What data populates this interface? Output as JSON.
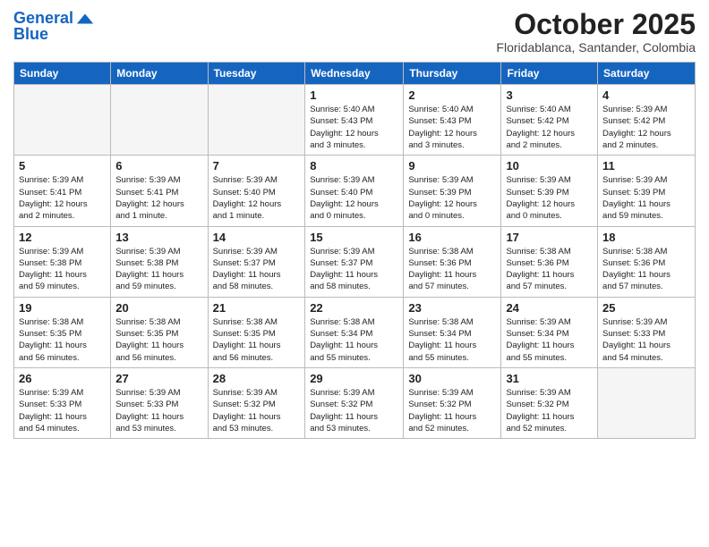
{
  "header": {
    "logo_line1": "General",
    "logo_line2": "Blue",
    "month": "October 2025",
    "location": "Floridablanca, Santander, Colombia"
  },
  "weekdays": [
    "Sunday",
    "Monday",
    "Tuesday",
    "Wednesday",
    "Thursday",
    "Friday",
    "Saturday"
  ],
  "weeks": [
    [
      {
        "day": "",
        "info": ""
      },
      {
        "day": "",
        "info": ""
      },
      {
        "day": "",
        "info": ""
      },
      {
        "day": "1",
        "info": "Sunrise: 5:40 AM\nSunset: 5:43 PM\nDaylight: 12 hours\nand 3 minutes."
      },
      {
        "day": "2",
        "info": "Sunrise: 5:40 AM\nSunset: 5:43 PM\nDaylight: 12 hours\nand 3 minutes."
      },
      {
        "day": "3",
        "info": "Sunrise: 5:40 AM\nSunset: 5:42 PM\nDaylight: 12 hours\nand 2 minutes."
      },
      {
        "day": "4",
        "info": "Sunrise: 5:39 AM\nSunset: 5:42 PM\nDaylight: 12 hours\nand 2 minutes."
      }
    ],
    [
      {
        "day": "5",
        "info": "Sunrise: 5:39 AM\nSunset: 5:41 PM\nDaylight: 12 hours\nand 2 minutes."
      },
      {
        "day": "6",
        "info": "Sunrise: 5:39 AM\nSunset: 5:41 PM\nDaylight: 12 hours\nand 1 minute."
      },
      {
        "day": "7",
        "info": "Sunrise: 5:39 AM\nSunset: 5:40 PM\nDaylight: 12 hours\nand 1 minute."
      },
      {
        "day": "8",
        "info": "Sunrise: 5:39 AM\nSunset: 5:40 PM\nDaylight: 12 hours\nand 0 minutes."
      },
      {
        "day": "9",
        "info": "Sunrise: 5:39 AM\nSunset: 5:39 PM\nDaylight: 12 hours\nand 0 minutes."
      },
      {
        "day": "10",
        "info": "Sunrise: 5:39 AM\nSunset: 5:39 PM\nDaylight: 12 hours\nand 0 minutes."
      },
      {
        "day": "11",
        "info": "Sunrise: 5:39 AM\nSunset: 5:39 PM\nDaylight: 11 hours\nand 59 minutes."
      }
    ],
    [
      {
        "day": "12",
        "info": "Sunrise: 5:39 AM\nSunset: 5:38 PM\nDaylight: 11 hours\nand 59 minutes."
      },
      {
        "day": "13",
        "info": "Sunrise: 5:39 AM\nSunset: 5:38 PM\nDaylight: 11 hours\nand 59 minutes."
      },
      {
        "day": "14",
        "info": "Sunrise: 5:39 AM\nSunset: 5:37 PM\nDaylight: 11 hours\nand 58 minutes."
      },
      {
        "day": "15",
        "info": "Sunrise: 5:39 AM\nSunset: 5:37 PM\nDaylight: 11 hours\nand 58 minutes."
      },
      {
        "day": "16",
        "info": "Sunrise: 5:38 AM\nSunset: 5:36 PM\nDaylight: 11 hours\nand 57 minutes."
      },
      {
        "day": "17",
        "info": "Sunrise: 5:38 AM\nSunset: 5:36 PM\nDaylight: 11 hours\nand 57 minutes."
      },
      {
        "day": "18",
        "info": "Sunrise: 5:38 AM\nSunset: 5:36 PM\nDaylight: 11 hours\nand 57 minutes."
      }
    ],
    [
      {
        "day": "19",
        "info": "Sunrise: 5:38 AM\nSunset: 5:35 PM\nDaylight: 11 hours\nand 56 minutes."
      },
      {
        "day": "20",
        "info": "Sunrise: 5:38 AM\nSunset: 5:35 PM\nDaylight: 11 hours\nand 56 minutes."
      },
      {
        "day": "21",
        "info": "Sunrise: 5:38 AM\nSunset: 5:35 PM\nDaylight: 11 hours\nand 56 minutes."
      },
      {
        "day": "22",
        "info": "Sunrise: 5:38 AM\nSunset: 5:34 PM\nDaylight: 11 hours\nand 55 minutes."
      },
      {
        "day": "23",
        "info": "Sunrise: 5:38 AM\nSunset: 5:34 PM\nDaylight: 11 hours\nand 55 minutes."
      },
      {
        "day": "24",
        "info": "Sunrise: 5:39 AM\nSunset: 5:34 PM\nDaylight: 11 hours\nand 55 minutes."
      },
      {
        "day": "25",
        "info": "Sunrise: 5:39 AM\nSunset: 5:33 PM\nDaylight: 11 hours\nand 54 minutes."
      }
    ],
    [
      {
        "day": "26",
        "info": "Sunrise: 5:39 AM\nSunset: 5:33 PM\nDaylight: 11 hours\nand 54 minutes."
      },
      {
        "day": "27",
        "info": "Sunrise: 5:39 AM\nSunset: 5:33 PM\nDaylight: 11 hours\nand 53 minutes."
      },
      {
        "day": "28",
        "info": "Sunrise: 5:39 AM\nSunset: 5:32 PM\nDaylight: 11 hours\nand 53 minutes."
      },
      {
        "day": "29",
        "info": "Sunrise: 5:39 AM\nSunset: 5:32 PM\nDaylight: 11 hours\nand 53 minutes."
      },
      {
        "day": "30",
        "info": "Sunrise: 5:39 AM\nSunset: 5:32 PM\nDaylight: 11 hours\nand 52 minutes."
      },
      {
        "day": "31",
        "info": "Sunrise: 5:39 AM\nSunset: 5:32 PM\nDaylight: 11 hours\nand 52 minutes."
      },
      {
        "day": "",
        "info": ""
      }
    ]
  ]
}
